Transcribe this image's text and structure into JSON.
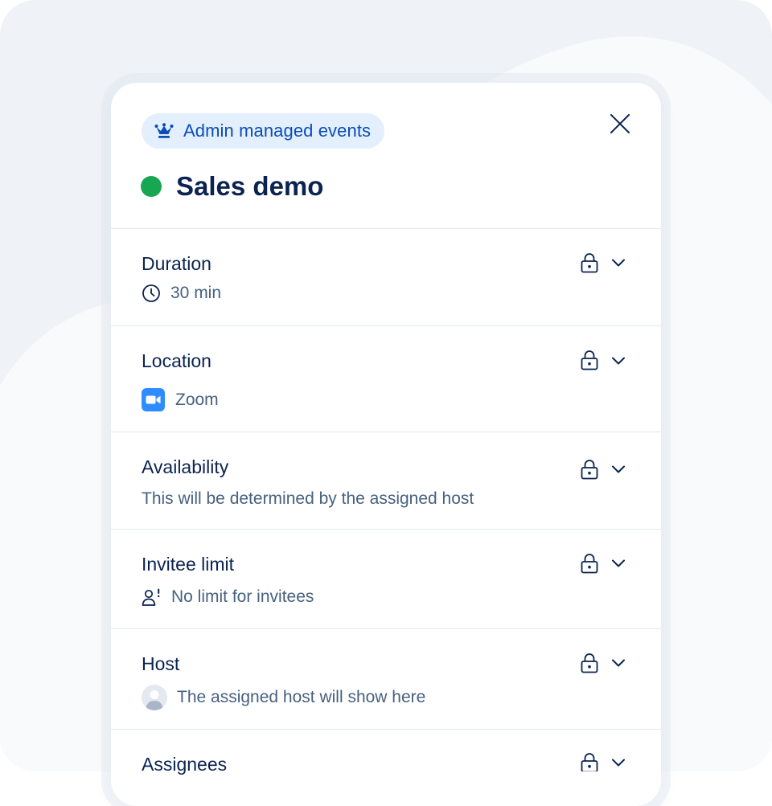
{
  "colors": {
    "background": "#eff3f8",
    "card": "#ffffff",
    "badge_bg": "#e3effc",
    "badge_text": "#0a4cb8",
    "status_dot": "#17a652",
    "title_text": "#0b2350",
    "secondary_text": "#47617f",
    "divider": "#e3e8ef",
    "zoom_blue": "#2d8cff"
  },
  "header": {
    "badge_label": "Admin managed events",
    "badge_icon": "crown-icon",
    "title": "Sales demo",
    "close_icon": "close-icon"
  },
  "sections": [
    {
      "label": "Duration",
      "value": "30 min",
      "icon": "clock-icon",
      "locked": true
    },
    {
      "label": "Location",
      "value": "Zoom",
      "icon": "zoom-icon",
      "locked": true
    },
    {
      "label": "Availability",
      "value": "This will be determined by the assigned host",
      "locked": true
    },
    {
      "label": "Invitee limit",
      "value": "No limit for invitees",
      "icon": "person-icon",
      "locked": true
    },
    {
      "label": "Host",
      "value": "The assigned host will show here",
      "icon": "avatar-placeholder",
      "locked": true
    },
    {
      "label": "Assignees",
      "locked": true
    }
  ]
}
